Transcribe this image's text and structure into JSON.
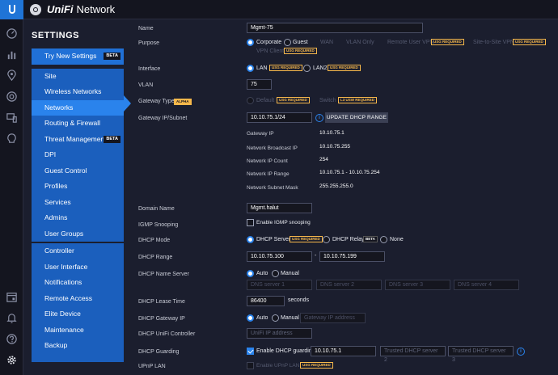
{
  "app": {
    "brand": "UniFi",
    "name": "Network"
  },
  "sidebar": {
    "heading": "SETTINGS",
    "try_new": {
      "label": "Try New Settings",
      "badge": "BETA"
    },
    "items": [
      {
        "label": "Site"
      },
      {
        "label": "Wireless Networks"
      },
      {
        "label": "Networks"
      },
      {
        "label": "Routing & Firewall"
      },
      {
        "label": "Threat Management",
        "badge": "BETA"
      },
      {
        "label": "DPI"
      },
      {
        "label": "Guest Control"
      },
      {
        "label": "Profiles"
      },
      {
        "label": "Services"
      },
      {
        "label": "Admins"
      },
      {
        "label": "User Groups"
      },
      {
        "label": "Controller"
      },
      {
        "label": "User Interface"
      },
      {
        "label": "Notifications"
      },
      {
        "label": "Remote Access"
      },
      {
        "label": "Elite Device"
      },
      {
        "label": "Maintenance"
      },
      {
        "label": "Backup"
      }
    ],
    "active": "Networks"
  },
  "form": {
    "name": {
      "label": "Name",
      "value": "Mgmt-75"
    },
    "purpose": {
      "label": "Purpose",
      "options": [
        "Corporate",
        "Guest",
        "WAN",
        "VLAN Only",
        "Remote User VPN",
        "Site-to-Site VPN",
        "VPN Client"
      ],
      "selected": "Corporate",
      "usg_tag": "USG REQUIRED"
    },
    "interface": {
      "label": "Interface",
      "options": [
        "LAN",
        "LAN2"
      ],
      "selected": "LAN",
      "usg_tag": "USG REQUIRED"
    },
    "vlan": {
      "label": "VLAN",
      "value": "75"
    },
    "gateway_type": {
      "label": "Gateway Type",
      "badge": "ALPHA",
      "options": [
        "Default",
        "Switch"
      ],
      "usg_tag": "USG REQUIRED",
      "l3_tag": "L3 USW REQUIRED"
    },
    "gateway_subnet": {
      "label": "Gateway IP/Subnet",
      "value": "10.10.75.1/24",
      "button": "UPDATE DHCP RANGE"
    },
    "network_info": [
      {
        "key": "Gateway IP",
        "value": "10.10.75.1"
      },
      {
        "key": "Network Broadcast IP",
        "value": "10.10.75.255"
      },
      {
        "key": "Network IP Count",
        "value": "254"
      },
      {
        "key": "Network IP Range",
        "value": "10.10.75.1 - 10.10.75.254"
      },
      {
        "key": "Network Subnet Mask",
        "value": "255.255.255.0"
      }
    ],
    "domain_name": {
      "label": "Domain Name",
      "value": "Mgmt.halut"
    },
    "igmp": {
      "label": "IGMP Snooping",
      "checkbox": "Enable IGMP snooping"
    },
    "dhcp_mode": {
      "label": "DHCP Mode",
      "options": [
        "DHCP Server",
        "DHCP Relay",
        "None"
      ],
      "selected": "DHCP Server",
      "usg_tag": "USG REQUIRED",
      "beta": "BETA"
    },
    "dhcp_range": {
      "label": "DHCP Range",
      "start": "10.10.75.100",
      "sep": "-",
      "end": "10.10.75.199"
    },
    "dhcp_ns": {
      "label": "DHCP Name Server",
      "options": [
        "Auto",
        "Manual"
      ],
      "selected": "Auto",
      "placeholders": [
        "DNS server 1",
        "DNS server 2",
        "DNS server 3",
        "DNS server 4"
      ]
    },
    "lease": {
      "label": "DHCP Lease Time",
      "value": "86400",
      "unit": "seconds"
    },
    "dhcp_gw": {
      "label": "DHCP Gateway IP",
      "options": [
        "Auto",
        "Manual"
      ],
      "selected": "Auto",
      "placeholder": "Gateway IP address"
    },
    "unifi_ctrl": {
      "label": "DHCP UniFi Controller",
      "placeholder": "UniFi IP address"
    },
    "guarding": {
      "label": "DHCP Guarding",
      "checkbox": "Enable DHCP guarding",
      "server1": "10.10.75.1",
      "placeholders": [
        "Trusted DHCP server 2",
        "Trusted DHCP server 3"
      ]
    },
    "upnp": {
      "label": "UPnP LAN",
      "checkbox": "Enable UPnP LAN",
      "usg_tag": "USG REQUIRED"
    }
  },
  "colors": {
    "accent": "#2a83ec",
    "sidebar": "#1b5fbd",
    "background": "#1b1e2e",
    "warning_tag": "#f7b84b"
  }
}
